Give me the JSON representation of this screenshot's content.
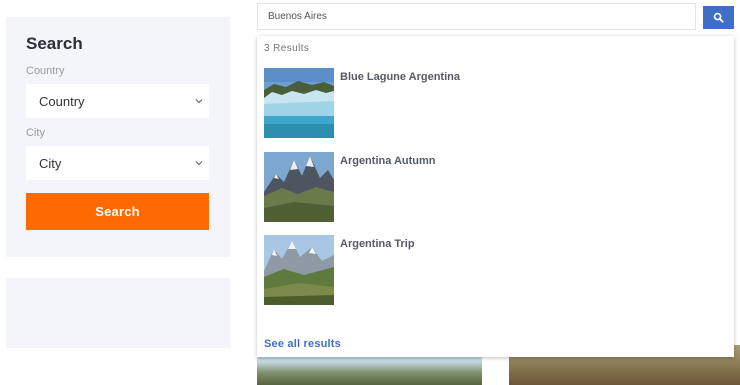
{
  "sidebar": {
    "title": "Search",
    "country_label": "Country",
    "country_value": "Country",
    "city_label": "City",
    "city_value": "City",
    "search_button": "Search"
  },
  "topbar": {
    "search_value": "Buenos Aires",
    "search_icon": "search-icon"
  },
  "dropdown": {
    "count_text": "3 Results",
    "results": [
      {
        "title": "Blue Lagune Argentina",
        "thumb": "glacier-photo"
      },
      {
        "title": "Argentina Autumn",
        "thumb": "mountain-peaks-photo"
      },
      {
        "title": "Argentina Trip",
        "thumb": "mountain-valley-photo"
      }
    ],
    "see_all": "See all results"
  },
  "colors": {
    "accent_orange": "#ff6a00",
    "accent_blue": "#3f6fc4",
    "panel_bg": "#f4f5fa"
  }
}
